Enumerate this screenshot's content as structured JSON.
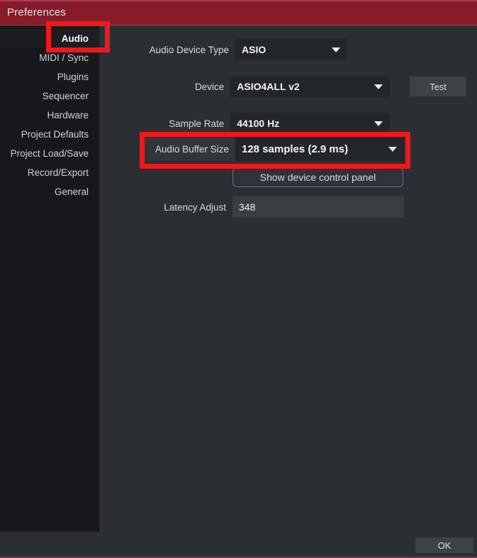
{
  "window": {
    "title": "Preferences",
    "titlebar_color": "#871b2a"
  },
  "sidebar": {
    "items": [
      {
        "label": "Audio",
        "selected": true
      },
      {
        "label": "MIDI / Sync",
        "selected": false
      },
      {
        "label": "Plugins",
        "selected": false
      },
      {
        "label": "Sequencer",
        "selected": false
      },
      {
        "label": "Hardware",
        "selected": false
      },
      {
        "label": "Project Defaults",
        "selected": false
      },
      {
        "label": "Project Load/Save",
        "selected": false
      },
      {
        "label": "Record/Export",
        "selected": false
      },
      {
        "label": "General",
        "selected": false
      }
    ]
  },
  "main": {
    "audio_device_type": {
      "label": "Audio Device Type",
      "value": "ASIO"
    },
    "device": {
      "label": "Device",
      "value": "ASIO4ALL v2"
    },
    "test_button": {
      "label": "Test"
    },
    "sample_rate": {
      "label": "Sample Rate",
      "value": "44100 Hz"
    },
    "audio_buffer_size": {
      "label": "Audio Buffer Size",
      "value": "128 samples (2.9 ms)"
    },
    "device_control_panel_button": {
      "label": "Show device control panel"
    },
    "latency_adjust": {
      "label": "Latency Adjust",
      "value": "348"
    }
  },
  "footer": {
    "ok_label": "OK"
  },
  "annotations": {
    "color": "#f01818",
    "items": [
      {
        "target": "sidebar-item-audio"
      },
      {
        "target": "audio-buffer-size-row"
      }
    ]
  }
}
